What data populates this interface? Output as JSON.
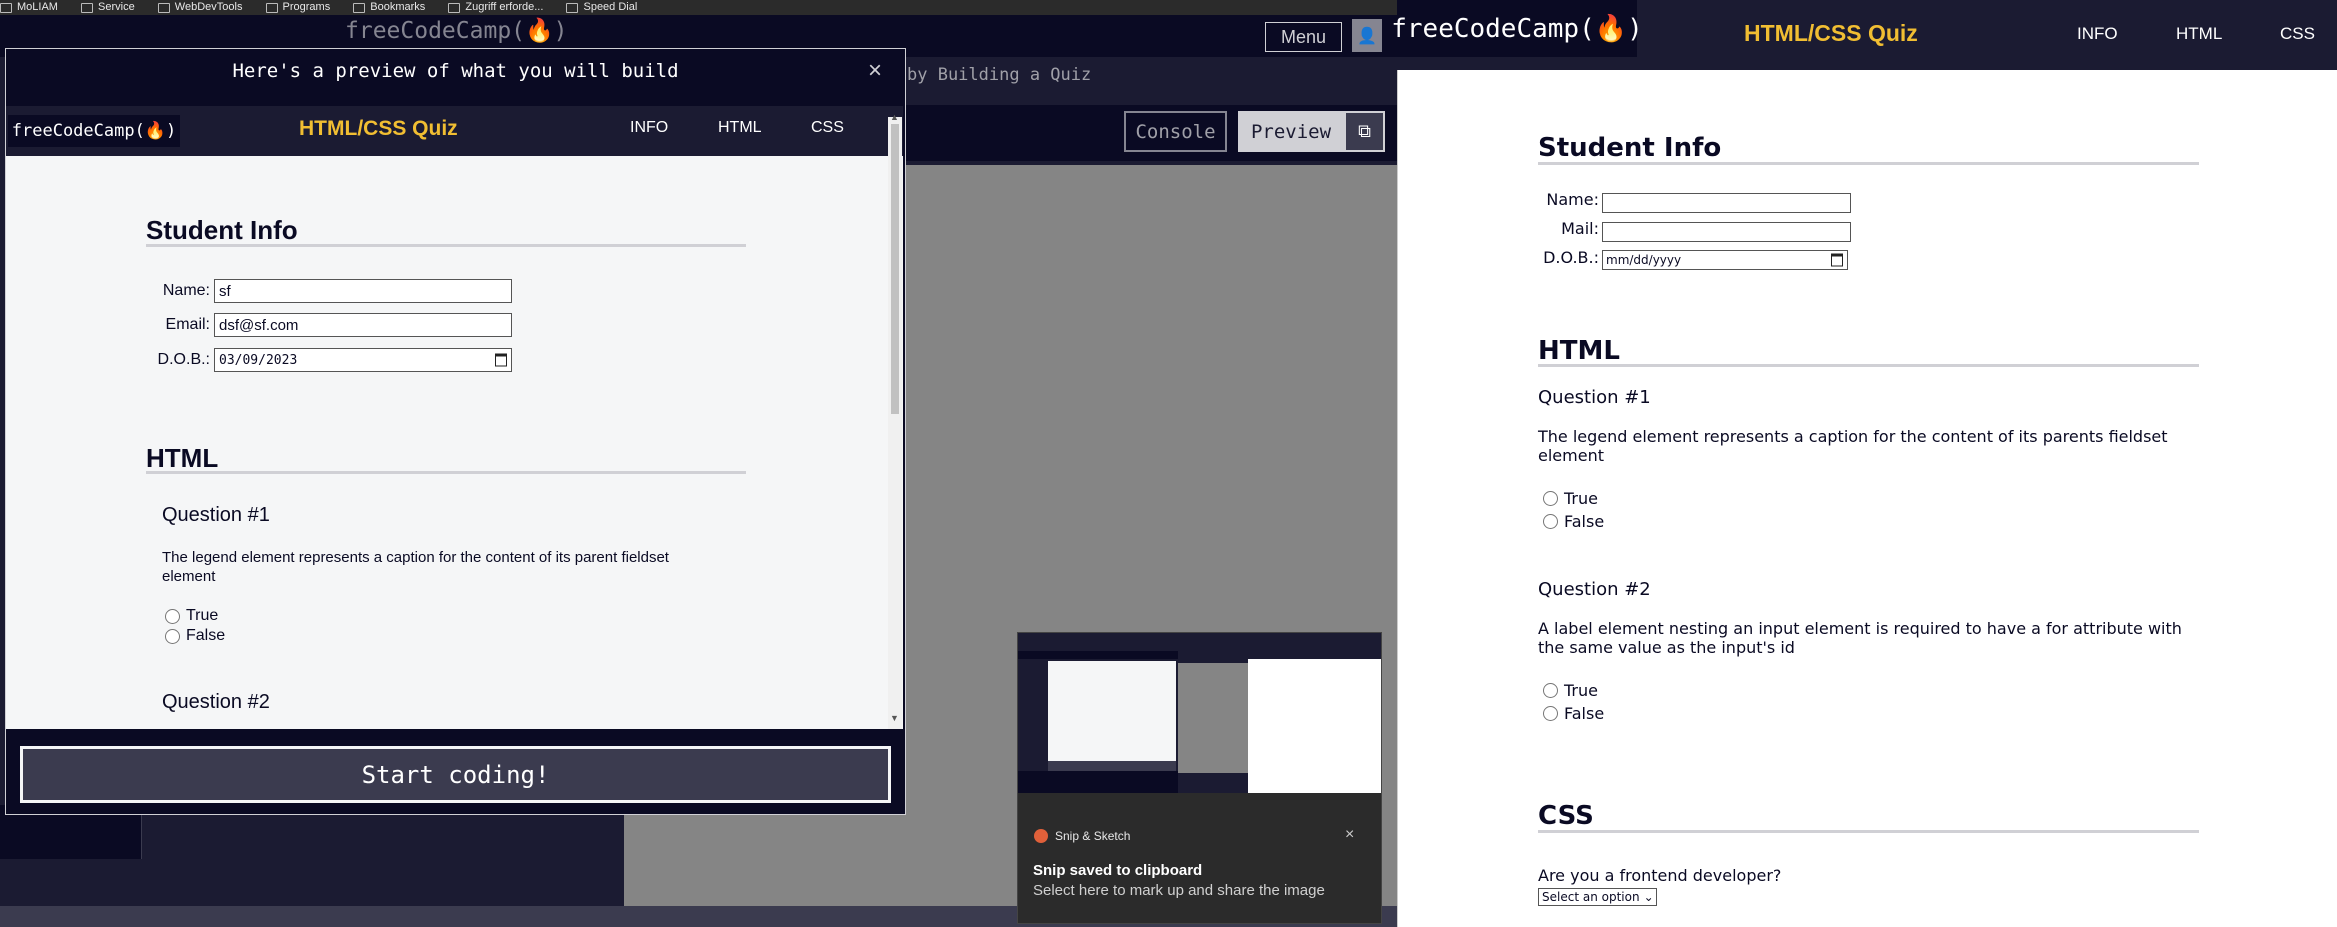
{
  "bookmarks": [
    "MoLIAM",
    "Service",
    "WebDevTools",
    "Programs",
    "Bookmarks",
    "Zugriff erforde...",
    "Speed Dial"
  ],
  "editor": {
    "brand": "freeCodeCamp(🔥)",
    "menu_label": "Menu",
    "breadcrumb": "by Building a Quiz",
    "console_label": "Console",
    "preview_label": "Preview"
  },
  "modal": {
    "title": "Here's a preview of what you will build",
    "close": "×",
    "start_button": "Start coding!",
    "page": {
      "logo": "freeCodeCamp(🔥)",
      "quiz_title": "HTML/CSS Quiz",
      "nav": [
        "INFO",
        "HTML",
        "CSS"
      ],
      "student_heading": "Student Info",
      "fields": [
        {
          "label": "Name:",
          "value": "sf"
        },
        {
          "label": "Email:",
          "value": "dsf@sf.com"
        },
        {
          "label": "D.O.B.:",
          "value": "03/09/2023"
        }
      ],
      "html_heading": "HTML",
      "q1_title": "Question #1",
      "q1_text": "The legend element represents a caption for the content of its parent fieldset element",
      "q1_options": [
        "True",
        "False"
      ],
      "q2_title": "Question #2"
    }
  },
  "toast": {
    "app": "Snip & Sketch",
    "title": "Snip saved to clipboard",
    "subtitle": "Select here to mark up and share the image",
    "close": "×"
  },
  "live": {
    "logo": "freeCodeCamp(🔥)",
    "quiz_title": "HTML/CSS Quiz",
    "nav": [
      "INFO",
      "HTML",
      "CSS"
    ],
    "student_heading": "Student Info",
    "fields": [
      {
        "label": "Name:",
        "value": ""
      },
      {
        "label": "Mail:",
        "value": ""
      },
      {
        "label": "D.O.B.:",
        "value": "mm/dd/yyyy"
      }
    ],
    "html_heading": "HTML",
    "q1_title": "Question #1",
    "q1_text": "The legend element represents a caption for the content of its parents fieldset element",
    "q1_options": [
      "True",
      "False"
    ],
    "q2_title": "Question #2",
    "q2_text": "A label element nesting an input element is required to have a for attribute with the same value as the input's id",
    "q2_options": [
      "True",
      "False"
    ],
    "css_heading": "CSS",
    "q3_text": "Are you a frontend developer?",
    "select_value": "Select an option"
  },
  "colors": {
    "brand_yellow": "#f1be32",
    "nav_dark": "#1b1b32",
    "deep": "#0a0a23"
  }
}
